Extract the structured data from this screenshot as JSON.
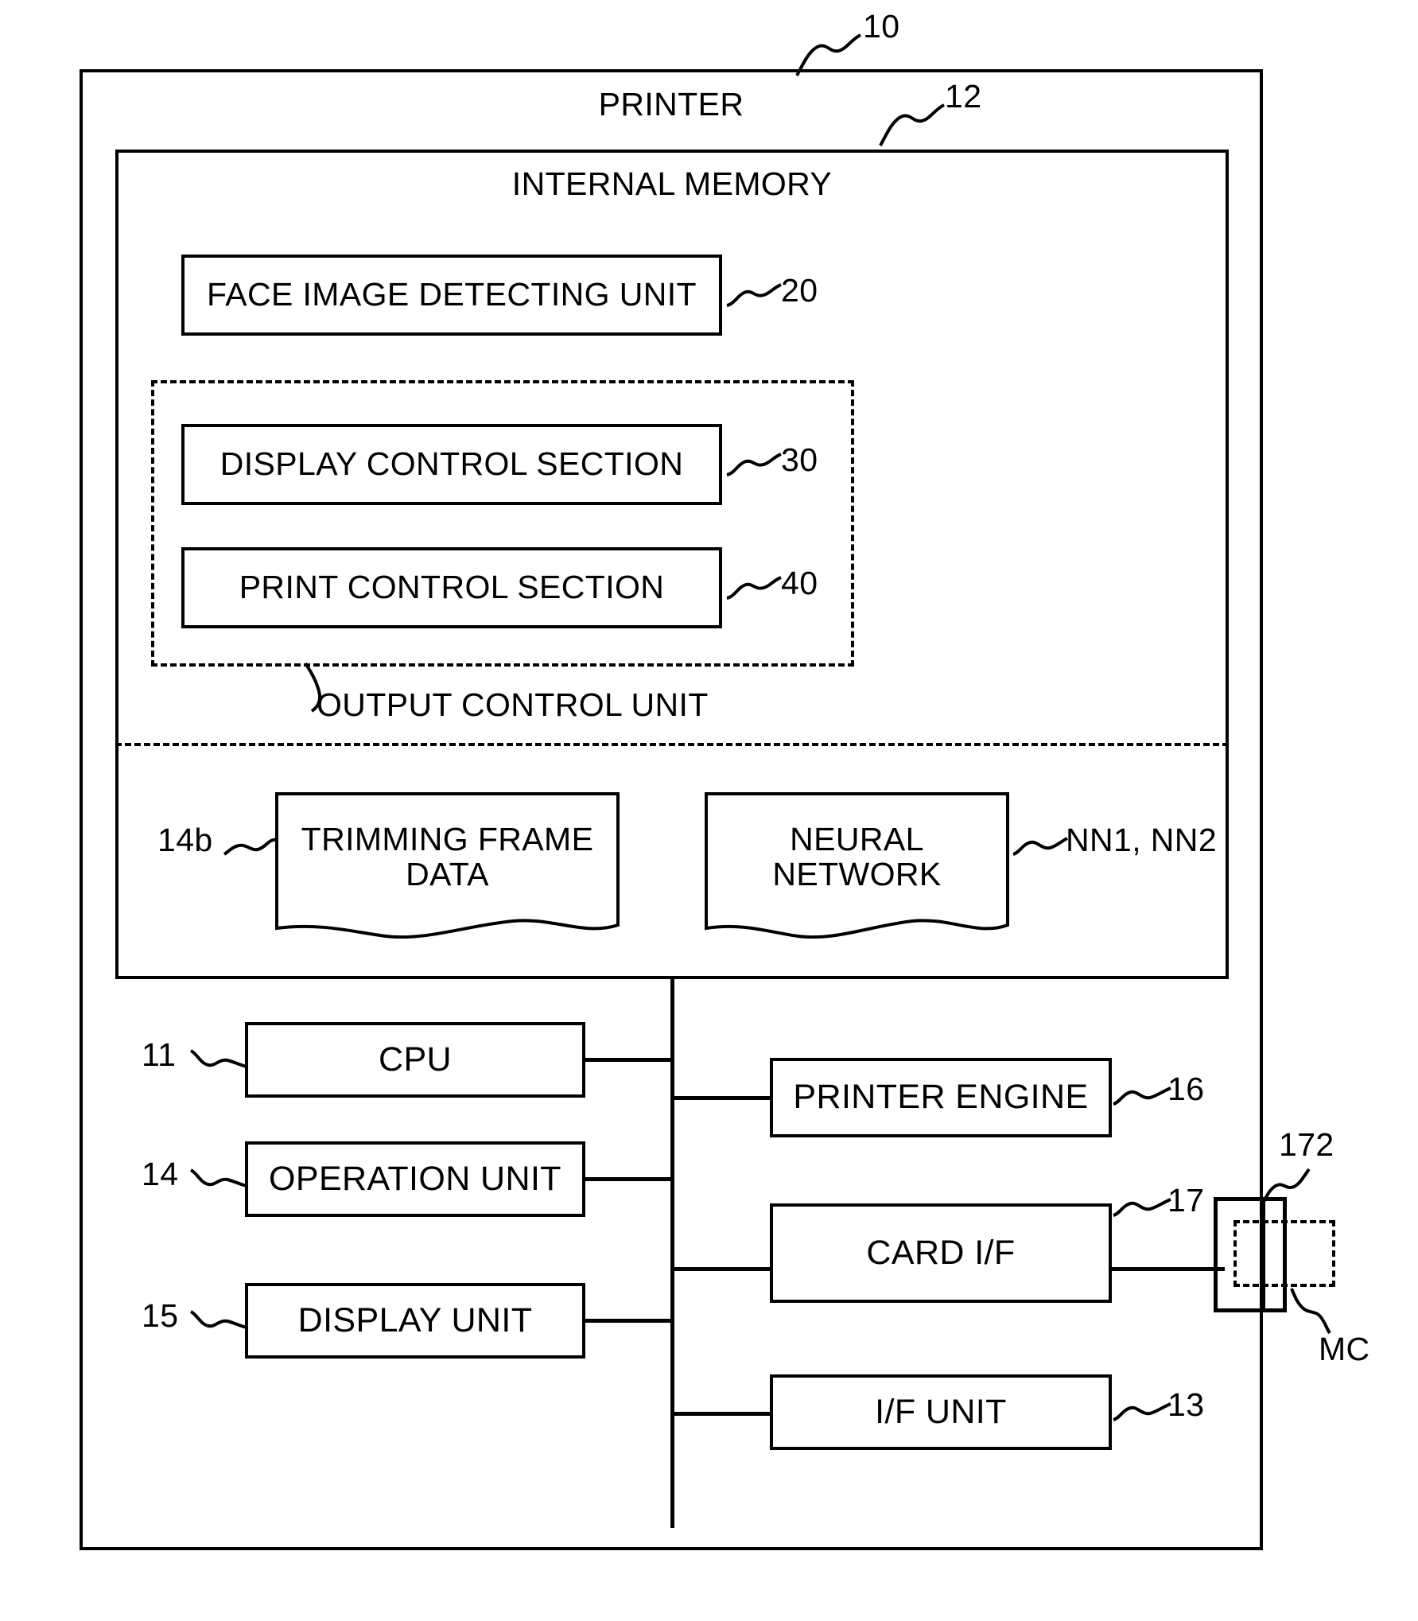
{
  "figure": {
    "outer_box": {
      "label": "PRINTER",
      "ref": "10"
    },
    "internal_memory": {
      "label": "INTERNAL MEMORY",
      "ref": "12"
    },
    "modules": [
      {
        "label": "FACE IMAGE DETECTING UNIT",
        "ref": "20"
      },
      {
        "label": "DISPLAY CONTROL SECTION",
        "ref": "30"
      },
      {
        "label": "PRINT CONTROL SECTION",
        "ref": "40"
      }
    ],
    "output_control_unit": {
      "label": "OUTPUT CONTROL UNIT"
    },
    "data_stores": [
      {
        "label": "TRIMMING FRAME\nDATA",
        "ref": "14b",
        "ref_side": "left"
      },
      {
        "label": "NEURAL\nNETWORK",
        "ref": "NN1, NN2",
        "ref_side": "right"
      }
    ],
    "left_column": [
      {
        "label": "CPU",
        "ref": "11"
      },
      {
        "label": "OPERATION UNIT",
        "ref": "14"
      },
      {
        "label": "DISPLAY UNIT",
        "ref": "15"
      }
    ],
    "right_column": [
      {
        "label": "PRINTER ENGINE",
        "ref": "16"
      },
      {
        "label": "CARD I/F",
        "ref": "17"
      },
      {
        "label": "I/F UNIT",
        "ref": "13"
      }
    ],
    "card_slot": {
      "ref": "172"
    },
    "memory_card": {
      "ref": "MC"
    }
  },
  "colors": {
    "stroke": "#000000",
    "background": "#ffffff"
  }
}
